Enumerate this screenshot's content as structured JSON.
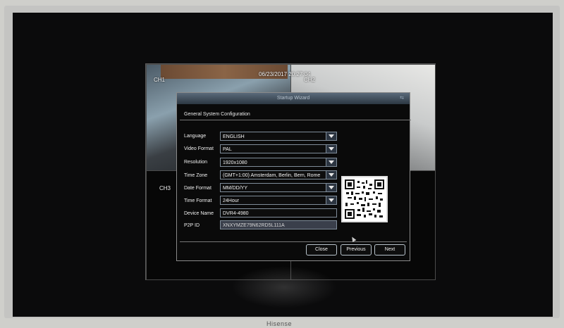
{
  "osd": {
    "timestamp": "06/23/2017 20:27:04",
    "ch1": "CH1",
    "ch2": "CH2",
    "ch3": "CH3"
  },
  "wizard": {
    "title": "Startup Wizard",
    "section_title": "General System Configuration",
    "fields": {
      "language": {
        "label": "Language",
        "value": "ENGLISH"
      },
      "video_format": {
        "label": "Video Format",
        "value": "PAL"
      },
      "resolution": {
        "label": "Resolution",
        "value": "1920x1080"
      },
      "time_zone": {
        "label": "Time Zone",
        "value": "(GMT+1:00) Amsterdam, Berlin, Bern, Rome"
      },
      "date_format": {
        "label": "Date Format",
        "value": "MM/DD/YY"
      },
      "time_format": {
        "label": "Time Format",
        "value": "24Hour"
      },
      "device_name": {
        "label": "Device Name",
        "value": "DVR4-4980"
      },
      "p2p_id": {
        "label": "P2P ID",
        "value": "XNXYMZE79N62RD5L111A"
      }
    },
    "buttons": {
      "close": "Close",
      "previous": "Previous",
      "next": "Next"
    }
  },
  "monitor": {
    "brand": "Hisense"
  },
  "colors": {
    "dialog_bg": "#0a0a0a",
    "title_bar": "#2c3742",
    "field_border": "#7f8c99"
  }
}
